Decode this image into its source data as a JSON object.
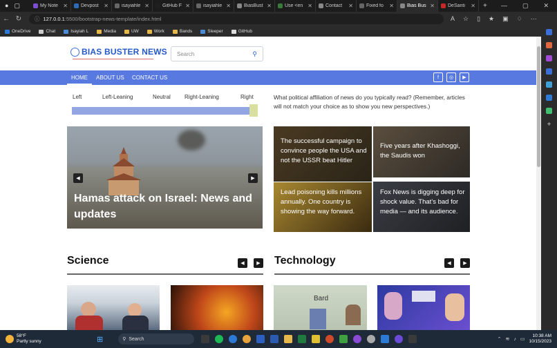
{
  "browser": {
    "tabs": [
      {
        "label": "My Note",
        "color": "#7b4fcf"
      },
      {
        "label": "Devpost",
        "color": "#2d6bb6"
      },
      {
        "label": "isayiahle",
        "color": "#666666"
      },
      {
        "label": "GitHub F",
        "color": "#1f1f1f"
      },
      {
        "label": "isayiahle",
        "color": "#666666"
      },
      {
        "label": "BiasBust",
        "color": "#888888"
      },
      {
        "label": "Use <en",
        "color": "#3a7a3a"
      },
      {
        "label": "Contact",
        "color": "#888888"
      },
      {
        "label": "Fixed fo",
        "color": "#666666"
      },
      {
        "label": "Bias Bus",
        "color": "#888888",
        "active": true
      },
      {
        "label": "DeSanti",
        "color": "#c62828"
      }
    ],
    "url_host": "127.0.0.1",
    "url_path": ":5500/bootstrap-news-template/index.html",
    "bookmarks": [
      {
        "label": "OneDrive",
        "color": "#2d7ad6"
      },
      {
        "label": "Chat",
        "color": "#cccccc"
      },
      {
        "label": "Isayiah L",
        "color": "#4a8ad6"
      },
      {
        "label": "Media",
        "color": "#e6b84a"
      },
      {
        "label": "UW",
        "color": "#e6b84a"
      },
      {
        "label": "Work",
        "color": "#e6b84a"
      },
      {
        "label": "Bands",
        "color": "#e6b84a"
      },
      {
        "label": "Sleeper",
        "color": "#4a8ad6"
      },
      {
        "label": "GitHub",
        "color": "#dddddd"
      }
    ]
  },
  "site": {
    "logo": "BIAS BUSTER NEWS",
    "search_placeholder": "Search",
    "nav": [
      "HOME",
      "ABOUT US",
      "CONTACT US"
    ],
    "social": [
      "f",
      "◎",
      "▶"
    ],
    "bias_labels": [
      "Left",
      "Left-Leaning",
      "Neutral",
      "Right-Leaning",
      "Right"
    ],
    "bias_slider_value": 1.0,
    "question": "What political affiliation of news do you typically read? (Remember, articles will not match your choice as to show you new perspectives.)",
    "hero_title": "Hamas attack on Israel: News and updates",
    "cards": [
      "The successful campaign to convince people the USA and not the USSR beat Hitler",
      "Five years after Khashoggi, the Saudis won",
      "Lead poisoning kills millions annually. One country is showing the way forward.",
      "Fox News is digging deep for shock value. That’s bad for media — and its audience."
    ],
    "sections": [
      "Science",
      "Technology"
    ],
    "tech_thumb_label": "Bard"
  },
  "taskbar": {
    "temp": "58°F",
    "weather": "Partly sunny",
    "search": "Search",
    "time": "10:38 AM",
    "date": "10/15/2023"
  }
}
